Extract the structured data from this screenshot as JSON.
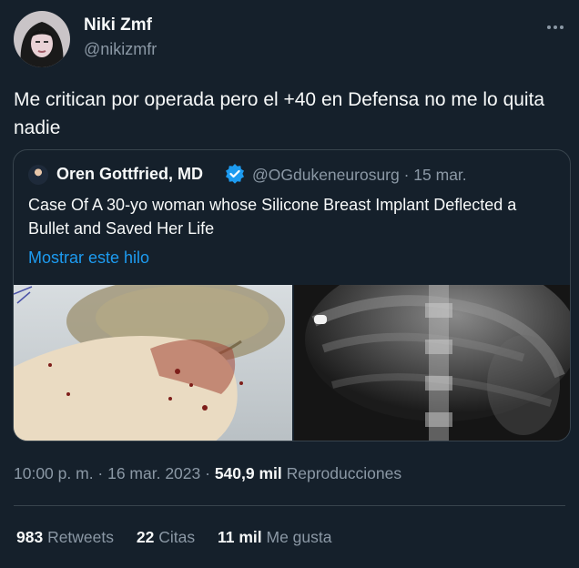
{
  "author": {
    "name": "Niki Zmf",
    "handle": "@nikizmfr"
  },
  "tweet": {
    "text": "Me critican por operada pero el +40 en Defensa no me lo quita nadie"
  },
  "quote": {
    "name": "Oren Gottfried, MD",
    "handle_date": "@OGdukeneurosurg · 15 mar.",
    "text": "Case Of A 30-yo woman whose Silicone Breast Implant Deflected a Bullet and Saved Her Life",
    "link": "Mostrar este hilo"
  },
  "meta": {
    "timestamp": "10:00 p. m. · 16 mar. 2023 · ",
    "views_count": "540,9 mil",
    "views_label": " Reproducciones"
  },
  "stats": {
    "retweets_count": "983",
    "retweets_label": " Retweets",
    "quotes_count": "22",
    "quotes_label": " Citas",
    "likes_count": "11 mil",
    "likes_label": " Me gusta"
  },
  "colors": {
    "background": "#15202b",
    "primary_text": "#f7f9f9",
    "secondary_text": "#8b98a5",
    "link": "#1d9bf0",
    "border": "#38444d"
  },
  "icons": [
    "more-icon",
    "verified-badge-icon"
  ]
}
